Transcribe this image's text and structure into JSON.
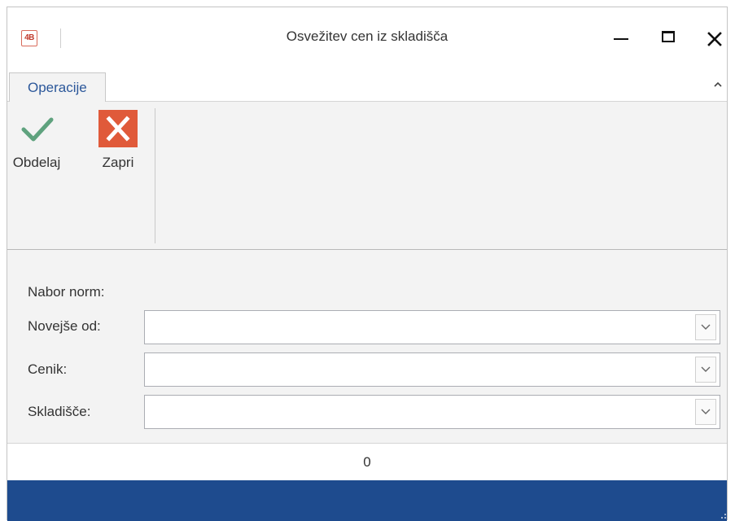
{
  "window": {
    "app_icon_text": "4B",
    "title": "Osvežitev cen iz skladišča"
  },
  "ribbon": {
    "tabs": [
      {
        "label": "Operacije"
      }
    ],
    "buttons": {
      "process_label": "Obdelaj",
      "close_label": "Zapri"
    }
  },
  "form": {
    "section_label": "Nabor norm:",
    "fields": [
      {
        "label": "Novejše od:",
        "value": ""
      },
      {
        "label": "Cenik:",
        "value": ""
      },
      {
        "label": "Skladišče:",
        "value": ""
      }
    ]
  },
  "status": {
    "count": "0"
  },
  "colors": {
    "accent_blue": "#1e4b8e",
    "tab_text": "#2b579a",
    "check_green": "#5fa27e",
    "close_red": "#e05a3a"
  },
  "icons": {
    "app": "app-logo-icon",
    "minimize": "minimize-icon",
    "maximize": "maximize-icon",
    "close": "close-icon",
    "collapse": "chevron-up-icon",
    "process": "checkmark-icon",
    "cancel": "x-icon",
    "dropdown": "chevron-down-icon"
  }
}
